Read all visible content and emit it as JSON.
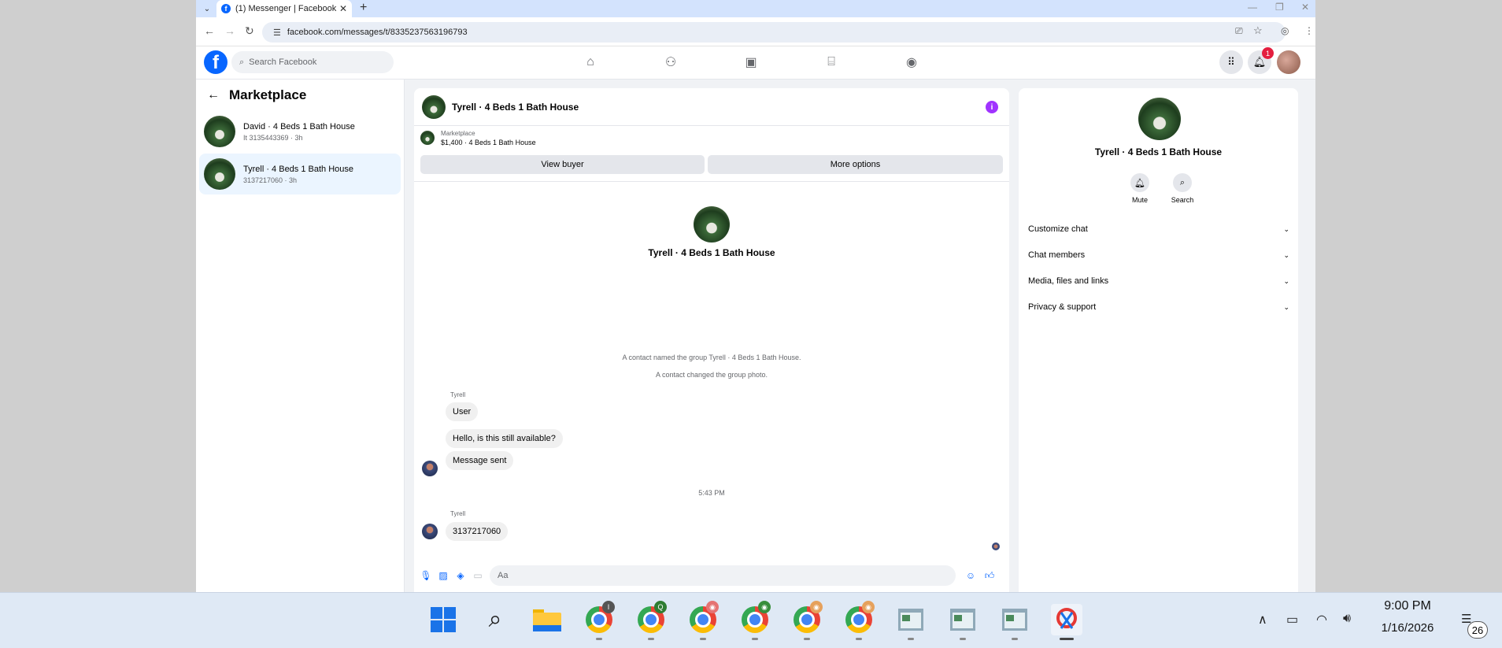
{
  "browser": {
    "tab_title": "(1) Messenger | Facebook",
    "url": "facebook.com/messages/t/8335237563196793"
  },
  "facebook": {
    "logo": "f",
    "search_placeholder": "Search Facebook",
    "notification_count": "1",
    "nav_icons": [
      "home-icon",
      "friends-icon",
      "video-icon",
      "marketplace-icon",
      "groups-icon"
    ]
  },
  "sidebar": {
    "title": "Marketplace",
    "conversations": [
      {
        "name": "David · 4 Beds 1 Bath House",
        "sub": "It 3135443369 · 3h"
      },
      {
        "name": "Tyrell · 4 Beds 1 Bath House",
        "sub": "3137217060 · 3h"
      }
    ]
  },
  "chat": {
    "title": "Tyrell · 4 Beds 1 Bath House",
    "marketplace_label": "Marketplace",
    "listing": "$1,400 · 4 Beds 1 Bath House",
    "view_buyer": "View buyer",
    "more_options": "More options",
    "center_name": "Tyrell · 4 Beds 1 Bath House",
    "system_1": "A contact named the group Tyrell · 4 Beds 1 Bath House.",
    "system_2": "A contact changed the group photo.",
    "sender_1": "Tyrell",
    "msg_1": "User",
    "msg_2": "Hello, is this still available?",
    "msg_3": "Message sent",
    "timestamp": "5:43 PM",
    "sender_2": "Tyrell",
    "msg_4": "3137217060",
    "composer_placeholder": "Aa"
  },
  "details": {
    "name": "Tyrell · 4 Beds 1 Bath House",
    "mute": "Mute",
    "search": "Search",
    "sections": [
      "Customize chat",
      "Chat members",
      "Media, files and links",
      "Privacy & support"
    ]
  },
  "taskbar": {
    "time": "9:00 PM",
    "date": "1/16/2026",
    "notification_count": "26"
  }
}
